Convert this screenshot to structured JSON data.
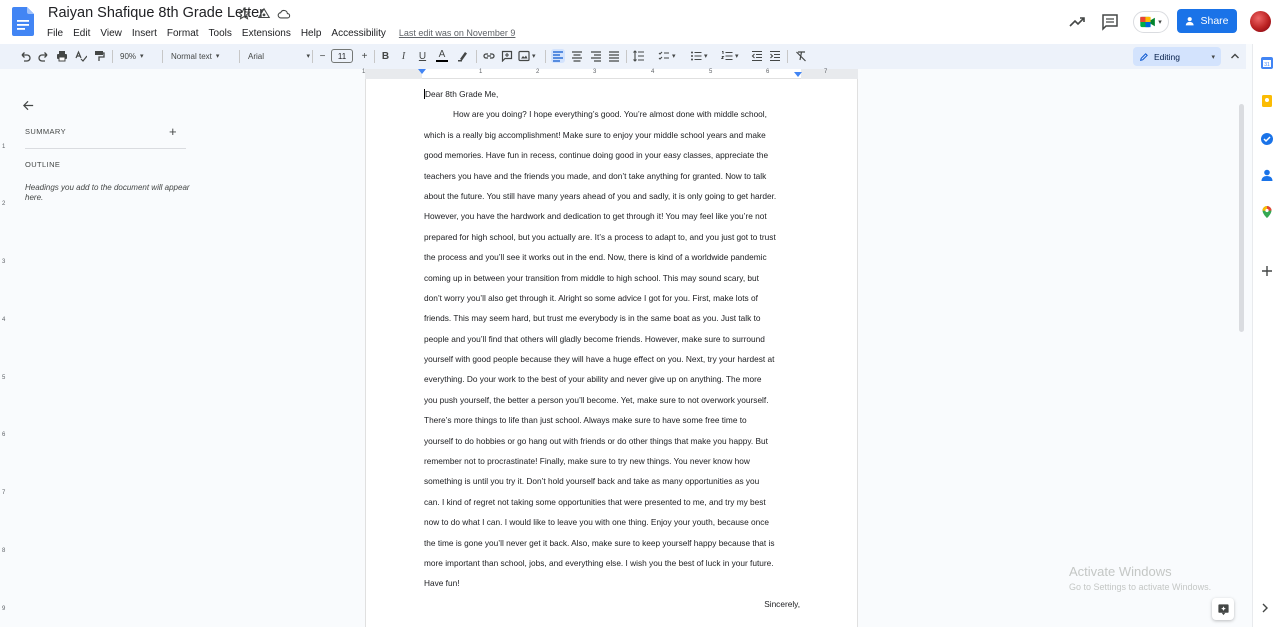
{
  "app": {
    "doc_title": "Raiyan Shafique 8th Grade Letter",
    "menus": [
      "File",
      "Edit",
      "View",
      "Insert",
      "Format",
      "Tools",
      "Extensions",
      "Help",
      "Accessibility"
    ],
    "last_edit": "Last edit was on November 9",
    "share_label": "Share"
  },
  "toolbar": {
    "zoom": "90%",
    "style": "Normal text",
    "font": "Arial",
    "font_size": "11",
    "minus": "−",
    "plus": "+",
    "bold": "B",
    "italic": "I",
    "underline": "U",
    "text_color": "A",
    "mode": "Editing"
  },
  "ruler": {
    "numbers": [
      "1",
      "1",
      "2",
      "3",
      "4",
      "5",
      "6",
      "7"
    ]
  },
  "vertical_ruler": {
    "numbers": [
      "1",
      "2",
      "3",
      "4",
      "5",
      "6",
      "7",
      "8",
      "9"
    ]
  },
  "sidebar": {
    "summary_label": "SUMMARY",
    "outline_label": "OUTLINE",
    "outline_hint": "Headings you add to the document will appear here."
  },
  "document": {
    "salutation": "Dear 8th Grade Me,",
    "lines": [
      "How are you doing? I hope everything’s good. You’re almost done with middle school,",
      "which is a really big accomplishment! Make sure to enjoy your middle school years and make",
      "good memories. Have fun in recess, continue doing good in your easy classes, appreciate the",
      "teachers you have and the friends you made, and don’t take anything for granted. Now to talk",
      "about the future. You still have many years ahead of you and sadly, it is only going to get harder.",
      "However, you have the hardwork and dedication to get through it! You may feel like you’re not",
      "prepared for high school, but you actually are. It’s a process to adapt to, and you just got to trust",
      "the process and you’ll see it works out in the end. Now, there is kind of a worldwide pandemic",
      "coming up in between your transition from middle to high school. This may sound scary, but",
      "don’t worry you’ll also get through it. Alright so some advice I got for you. First, make lots of",
      "friends. This may seem hard, but trust me everybody is in the same boat as you. Just talk to",
      "people and you’ll find that others will gladly become friends. However, make sure to surround",
      "yourself with good people because they will have a huge effect on you. Next, try your hardest at",
      "everything. Do your work to the best of your ability and never give up on anything. The more",
      "you push yourself, the better a person you’ll become. Yet, make sure to not overwork yourself.",
      "There’s more things to life than just school. Always make sure to have some free time to",
      "yourself to do hobbies or go hang out with friends or do other things that make you happy. But",
      "remember not to procrastinate! Finally, make sure to try new things. You never know how",
      "something is until you try it. Don’t hold yourself back and take as many opportunities as you",
      "can. I kind of regret not taking some opportunities that were presented to me, and try my best",
      "now to do what I can. I would like to leave you with one thing. Enjoy your youth, because once",
      "the time is gone you’ll never get it back. Also, make sure to keep yourself happy because that is",
      "more important than school, jobs, and everything else. I wish you the best of luck in your future.",
      "Have fun!"
    ],
    "closing": "Sincerely,"
  },
  "watermark": {
    "title": "Activate Windows",
    "subtitle": "Go to Settings to activate Windows."
  },
  "colors": {
    "accent": "#1a73e8",
    "toolbar_bg": "#edf2fa",
    "canvas_bg": "#f9fbfd"
  }
}
